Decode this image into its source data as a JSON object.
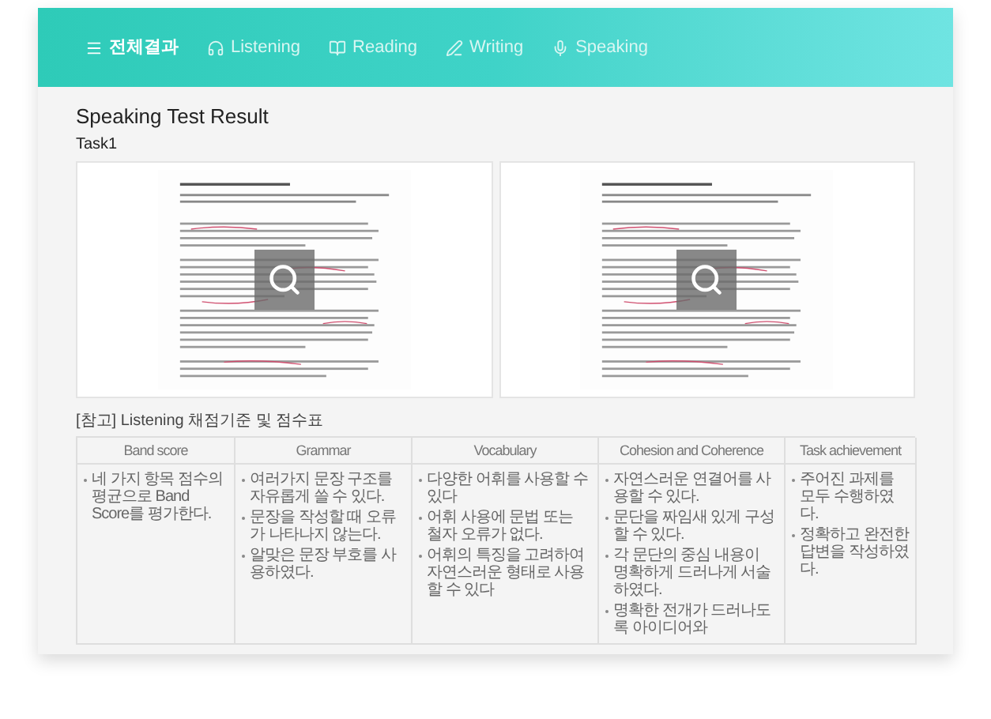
{
  "tabs": [
    {
      "label": "전체결과",
      "kind": "menu",
      "selected": true
    },
    {
      "label": "Listening",
      "kind": "headphones",
      "selected": false
    },
    {
      "label": "Reading",
      "kind": "book",
      "selected": false
    },
    {
      "label": "Writing",
      "kind": "pen",
      "selected": false
    },
    {
      "label": "Speaking",
      "kind": "mic",
      "selected": false
    }
  ],
  "title": "Speaking Test Result",
  "task": "Task1",
  "scans": [
    {
      "kind": "document"
    },
    {
      "kind": "document"
    }
  ],
  "criteria": {
    "caption": "[참고] Listening 채점기준 및 점수표",
    "columns": [
      {
        "heading": "Band score",
        "items": [
          "네 가지 항목 점수의 평균으로 Band Score를 평가한다."
        ]
      },
      {
        "heading": "Grammar",
        "items": [
          "여러가지 문장 구조를 자유롭게 쓸 수 있다.",
          "문장을 작성할 때 오류가 나타나지 않는다.",
          "알맞은 문장 부호를 사용하였다."
        ]
      },
      {
        "heading": "Vocabulary",
        "items": [
          "다양한 어휘를 사용할 수 있다",
          "어휘 사용에 문법 또는 철자 오류가 없다.",
          "어휘의 특징을 고려하여 자연스러운 형태로 사용할 수 있다"
        ]
      },
      {
        "heading": "Cohesion and Coherence",
        "items": [
          "자연스러운 연결어를 사용할 수 있다.",
          "문단을 짜임새 있게 구성할 수 있다.",
          "각 문단의 중심 내용이 명확하게 드러나게 서술하였다.",
          "명확한 전개가 드러나도록 아이디어와"
        ]
      },
      {
        "heading": "Task achievement",
        "items": [
          "주어진 과제를 모두 수행하였다.",
          "정확하고 완전한 답변을 작성하였다."
        ]
      }
    ]
  }
}
